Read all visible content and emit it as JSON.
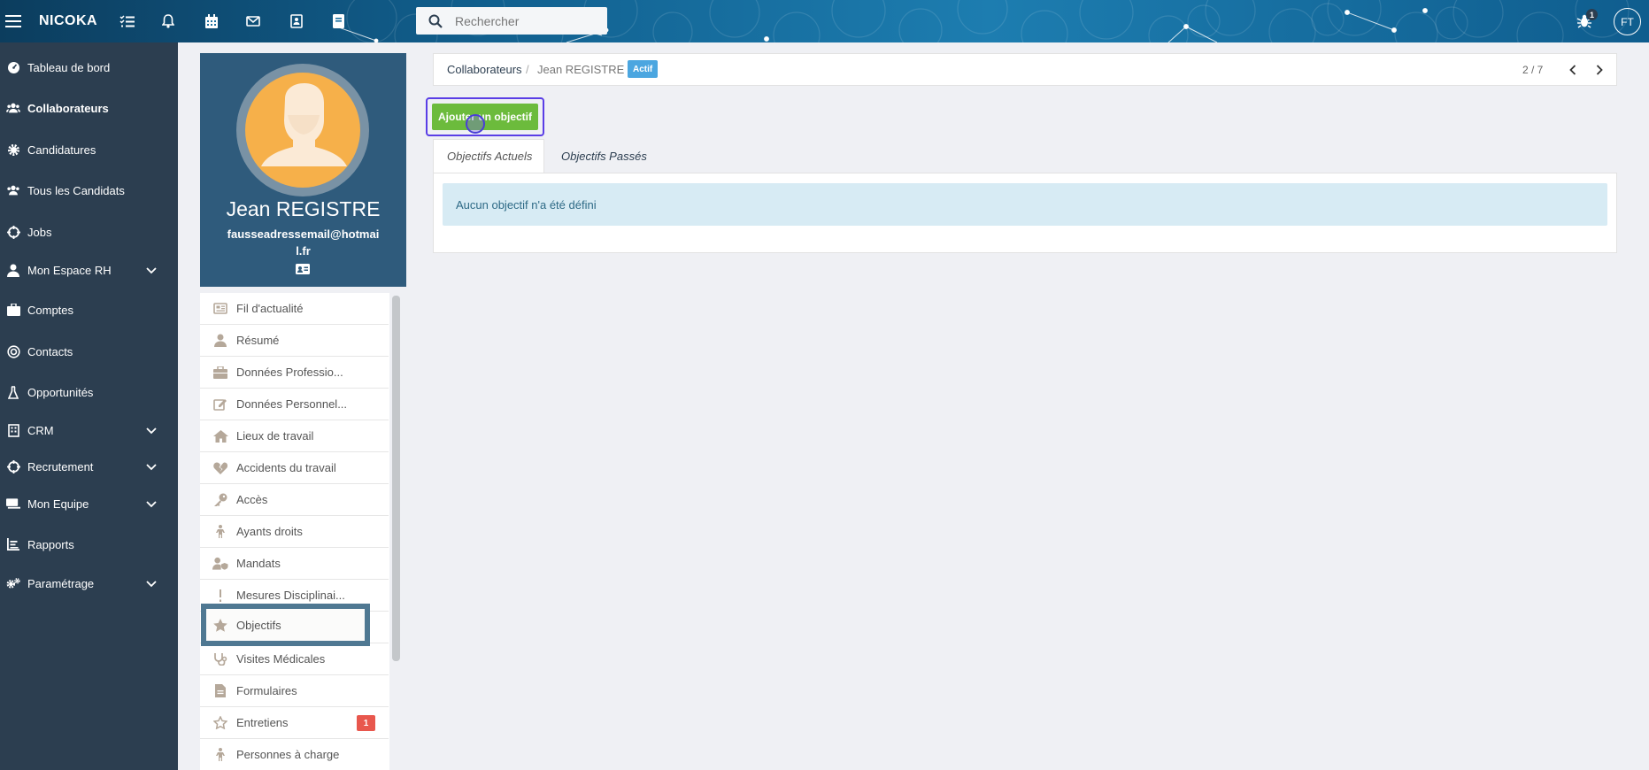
{
  "topbar": {
    "brand": "NICOKA",
    "search_placeholder": "Rechercher",
    "notification_count": "1",
    "user_initials": "FT",
    "icons": [
      "menu-icon",
      "tasks-icon",
      "bell-icon",
      "calendar-icon",
      "mail-icon",
      "contacts-icon",
      "book-icon",
      "search-icon",
      "bug-icon"
    ]
  },
  "sidebar": {
    "items": [
      {
        "label": "Tableau de bord",
        "icon": "dashboard-icon"
      },
      {
        "label": "Collaborateurs",
        "icon": "users-icon",
        "active": true
      },
      {
        "label": "Candidatures",
        "icon": "gear-icon"
      },
      {
        "label": "Tous les Candidats",
        "icon": "users-icon"
      },
      {
        "label": "Jobs",
        "icon": "crosshair-icon"
      },
      {
        "label": "Mon Espace RH",
        "icon": "user-icon",
        "expandable": true
      },
      {
        "label": "Comptes",
        "icon": "briefcase-icon"
      },
      {
        "label": "Contacts",
        "icon": "target-icon"
      },
      {
        "label": "Opportunités",
        "icon": "flask-icon"
      },
      {
        "label": "CRM",
        "icon": "building-icon",
        "expandable": true
      },
      {
        "label": "Recrutement",
        "icon": "crosshair-icon",
        "expandable": true
      },
      {
        "label": "Mon Equipe",
        "icon": "keyboard-icon",
        "expandable": true
      },
      {
        "label": "Rapports",
        "icon": "chart-icon"
      },
      {
        "label": "Paramétrage",
        "icon": "gears-icon",
        "expandable": true
      }
    ]
  },
  "profile": {
    "name": "Jean REGISTRE",
    "email": "fausseadressemail@hotmail.fr"
  },
  "submenu": {
    "items": [
      {
        "label": "Fil d'actualité",
        "icon": "newspaper-icon"
      },
      {
        "label": "Résumé",
        "icon": "user-icon"
      },
      {
        "label": "Données Professio...",
        "icon": "briefcase-icon"
      },
      {
        "label": "Données Personnel...",
        "icon": "edit-icon"
      },
      {
        "label": "Lieux de travail",
        "icon": "home-icon"
      },
      {
        "label": "Accidents du travail",
        "icon": "broken-heart-icon"
      },
      {
        "label": "Accès",
        "icon": "key-icon"
      },
      {
        "label": "Ayants droits",
        "icon": "child-icon"
      },
      {
        "label": "Mandats",
        "icon": "user-shield-icon"
      },
      {
        "label": "Mesures Disciplinai...",
        "icon": "exclamation-icon"
      },
      {
        "label": "Objectifs",
        "icon": "star-icon",
        "selected": true
      },
      {
        "label": "Visites Médicales",
        "icon": "stethoscope-icon"
      },
      {
        "label": "Formulaires",
        "icon": "file-icon"
      },
      {
        "label": "Entretiens",
        "icon": "star-outline-icon",
        "badge": "1"
      },
      {
        "label": "Personnes à charge",
        "icon": "child-icon"
      }
    ]
  },
  "breadcrumb": {
    "parent": "Collaborateurs",
    "separator": "/",
    "current": "Jean REGISTRE",
    "status": "Actif",
    "pager": "2 / 7"
  },
  "actions": {
    "add_objective": "Ajouter un objectif"
  },
  "tabs": [
    {
      "label": "Objectifs Actuels",
      "active": true
    },
    {
      "label": "Objectifs Passés",
      "active": false
    }
  ],
  "panel": {
    "empty_message": "Aucun objectif n'a été défini"
  },
  "colors": {
    "sidebar_bg": "#2c3e50",
    "profile_bg": "#2f5b7c",
    "primary_button": "#6cbb3c",
    "status_badge": "#4ba6e0",
    "alert_bg": "#d7ebf4",
    "count_badge": "#e8574d"
  }
}
